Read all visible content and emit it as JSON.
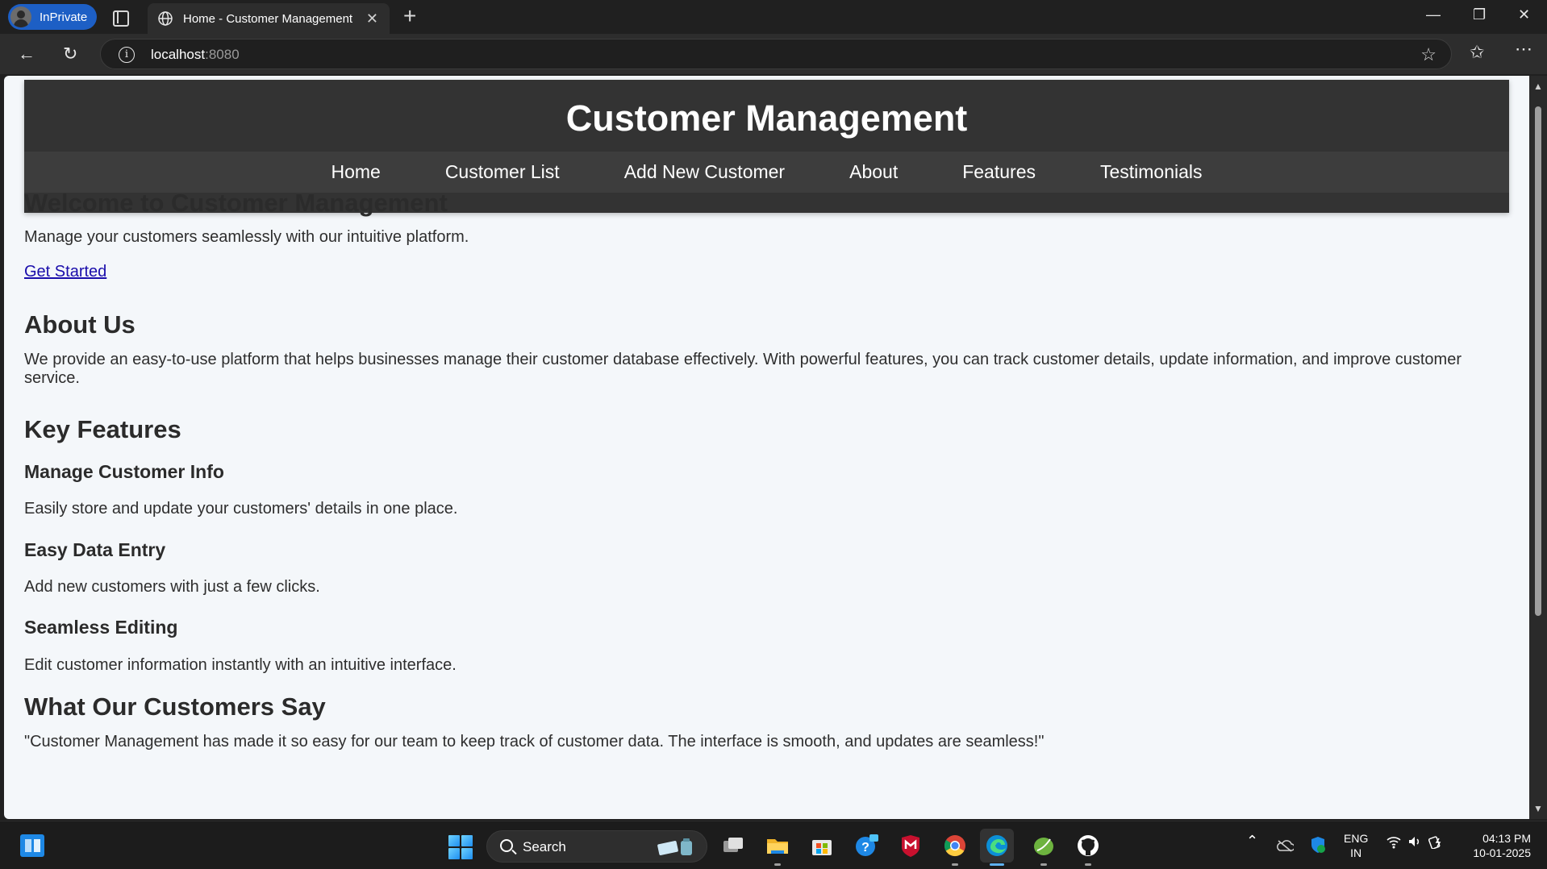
{
  "browser": {
    "profile_label": "InPrivate",
    "tab_title": "Home - Customer Management",
    "url_host": "localhost",
    "url_port": ":8080"
  },
  "site": {
    "title": "Customer Management",
    "nav": [
      "Home",
      "Customer List",
      "Add New Customer",
      "About",
      "Features",
      "Testimonials"
    ]
  },
  "welcome": {
    "heading": "Welcome to Customer Management",
    "text": "Manage your customers seamlessly with our intuitive platform.",
    "cta": "Get Started"
  },
  "about": {
    "heading": "About Us",
    "text": "We provide an easy-to-use platform that helps businesses manage their customer database effectively. With powerful features, you can track customer details, update information, and improve customer service."
  },
  "features": {
    "heading": "Key Features",
    "items": [
      {
        "title": "Manage Customer Info",
        "text": "Easily store and update your customers' details in one place."
      },
      {
        "title": "Easy Data Entry",
        "text": "Add new customers with just a few clicks."
      },
      {
        "title": "Seamless Editing",
        "text": "Edit customer information instantly with an intuitive interface."
      }
    ]
  },
  "testimonials": {
    "heading": "What Our Customers Say",
    "quote": "\"Customer Management has made it so easy for our team to keep track of customer data. The interface is smooth, and updates are seamless!\""
  },
  "taskbar": {
    "search_label": "Search",
    "lang_top": "ENG",
    "lang_bottom": "IN",
    "time": "04:13 PM",
    "date": "10-01-2025"
  }
}
